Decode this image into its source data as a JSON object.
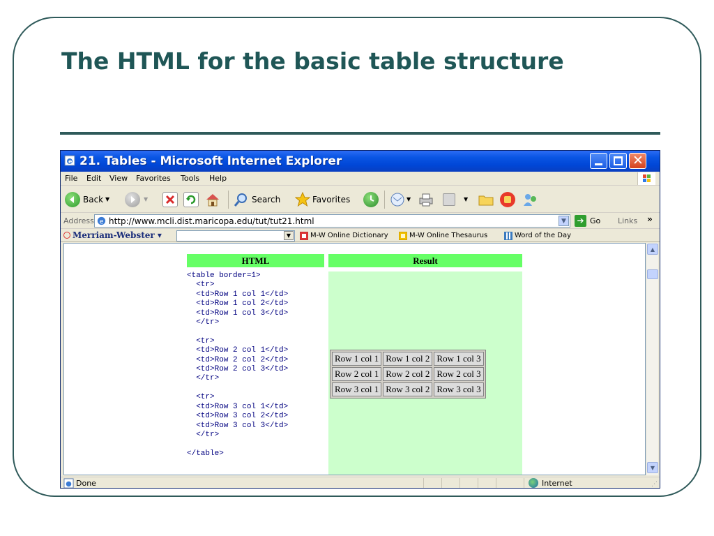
{
  "slide": {
    "title": "The HTML for the basic table structure"
  },
  "browser": {
    "title": "21. Tables - Microsoft Internet Explorer",
    "menu": [
      "File",
      "Edit",
      "View",
      "Favorites",
      "Tools",
      "Help"
    ],
    "toolbar": {
      "back": "Back",
      "search": "Search",
      "favorites": "Favorites"
    },
    "address": {
      "label": "Address",
      "url": "http://www.mcli.dist.maricopa.edu/tut/tut21.html",
      "go": "Go",
      "links": "Links"
    },
    "mw_bar": {
      "brand": "Merriam-Webster",
      "links": [
        "M-W Online Dictionary",
        "M-W Online Thesaurus",
        "Word of the Day"
      ]
    },
    "status": {
      "text": "Done",
      "zone": "Internet"
    }
  },
  "page": {
    "html_header": "HTML",
    "result_header": "Result",
    "code": "<table border=1>\n  <tr>\n  <td>Row 1 col 1</td>\n  <td>Row 1 col 2</td>\n  <td>Row 1 col 3</td>\n  </tr>\n\n  <tr>\n  <td>Row 2 col 1</td>\n  <td>Row 2 col 2</td>\n  <td>Row 2 col 3</td>\n  </tr>\n\n  <tr>\n  <td>Row 3 col 1</td>\n  <td>Row 3 col 2</td>\n  <td>Row 3 col 3</td>\n  </tr>\n\n</table>",
    "table": [
      [
        "Row 1 col 1",
        "Row 1 col 2",
        "Row 1 col 3"
      ],
      [
        "Row 2 col 1",
        "Row 2 col 2",
        "Row 2 col 3"
      ],
      [
        "Row 3 col 1",
        "Row 3 col 2",
        "Row 3 col 3"
      ]
    ]
  },
  "colors": {
    "slide_title": "#1f5656",
    "header_green": "#66ff66",
    "result_green": "#ccffcc",
    "code_blue": "#000080"
  },
  "icons": [
    "ie-page-icon",
    "back-icon",
    "forward-icon",
    "stop-icon",
    "refresh-icon",
    "home-icon",
    "search-icon",
    "favorites-icon",
    "history-icon",
    "mail-icon",
    "print-icon",
    "edit-icon",
    "folder-icon",
    "messenger-icon",
    "people-icon",
    "go-icon",
    "internet-zone-icon"
  ]
}
